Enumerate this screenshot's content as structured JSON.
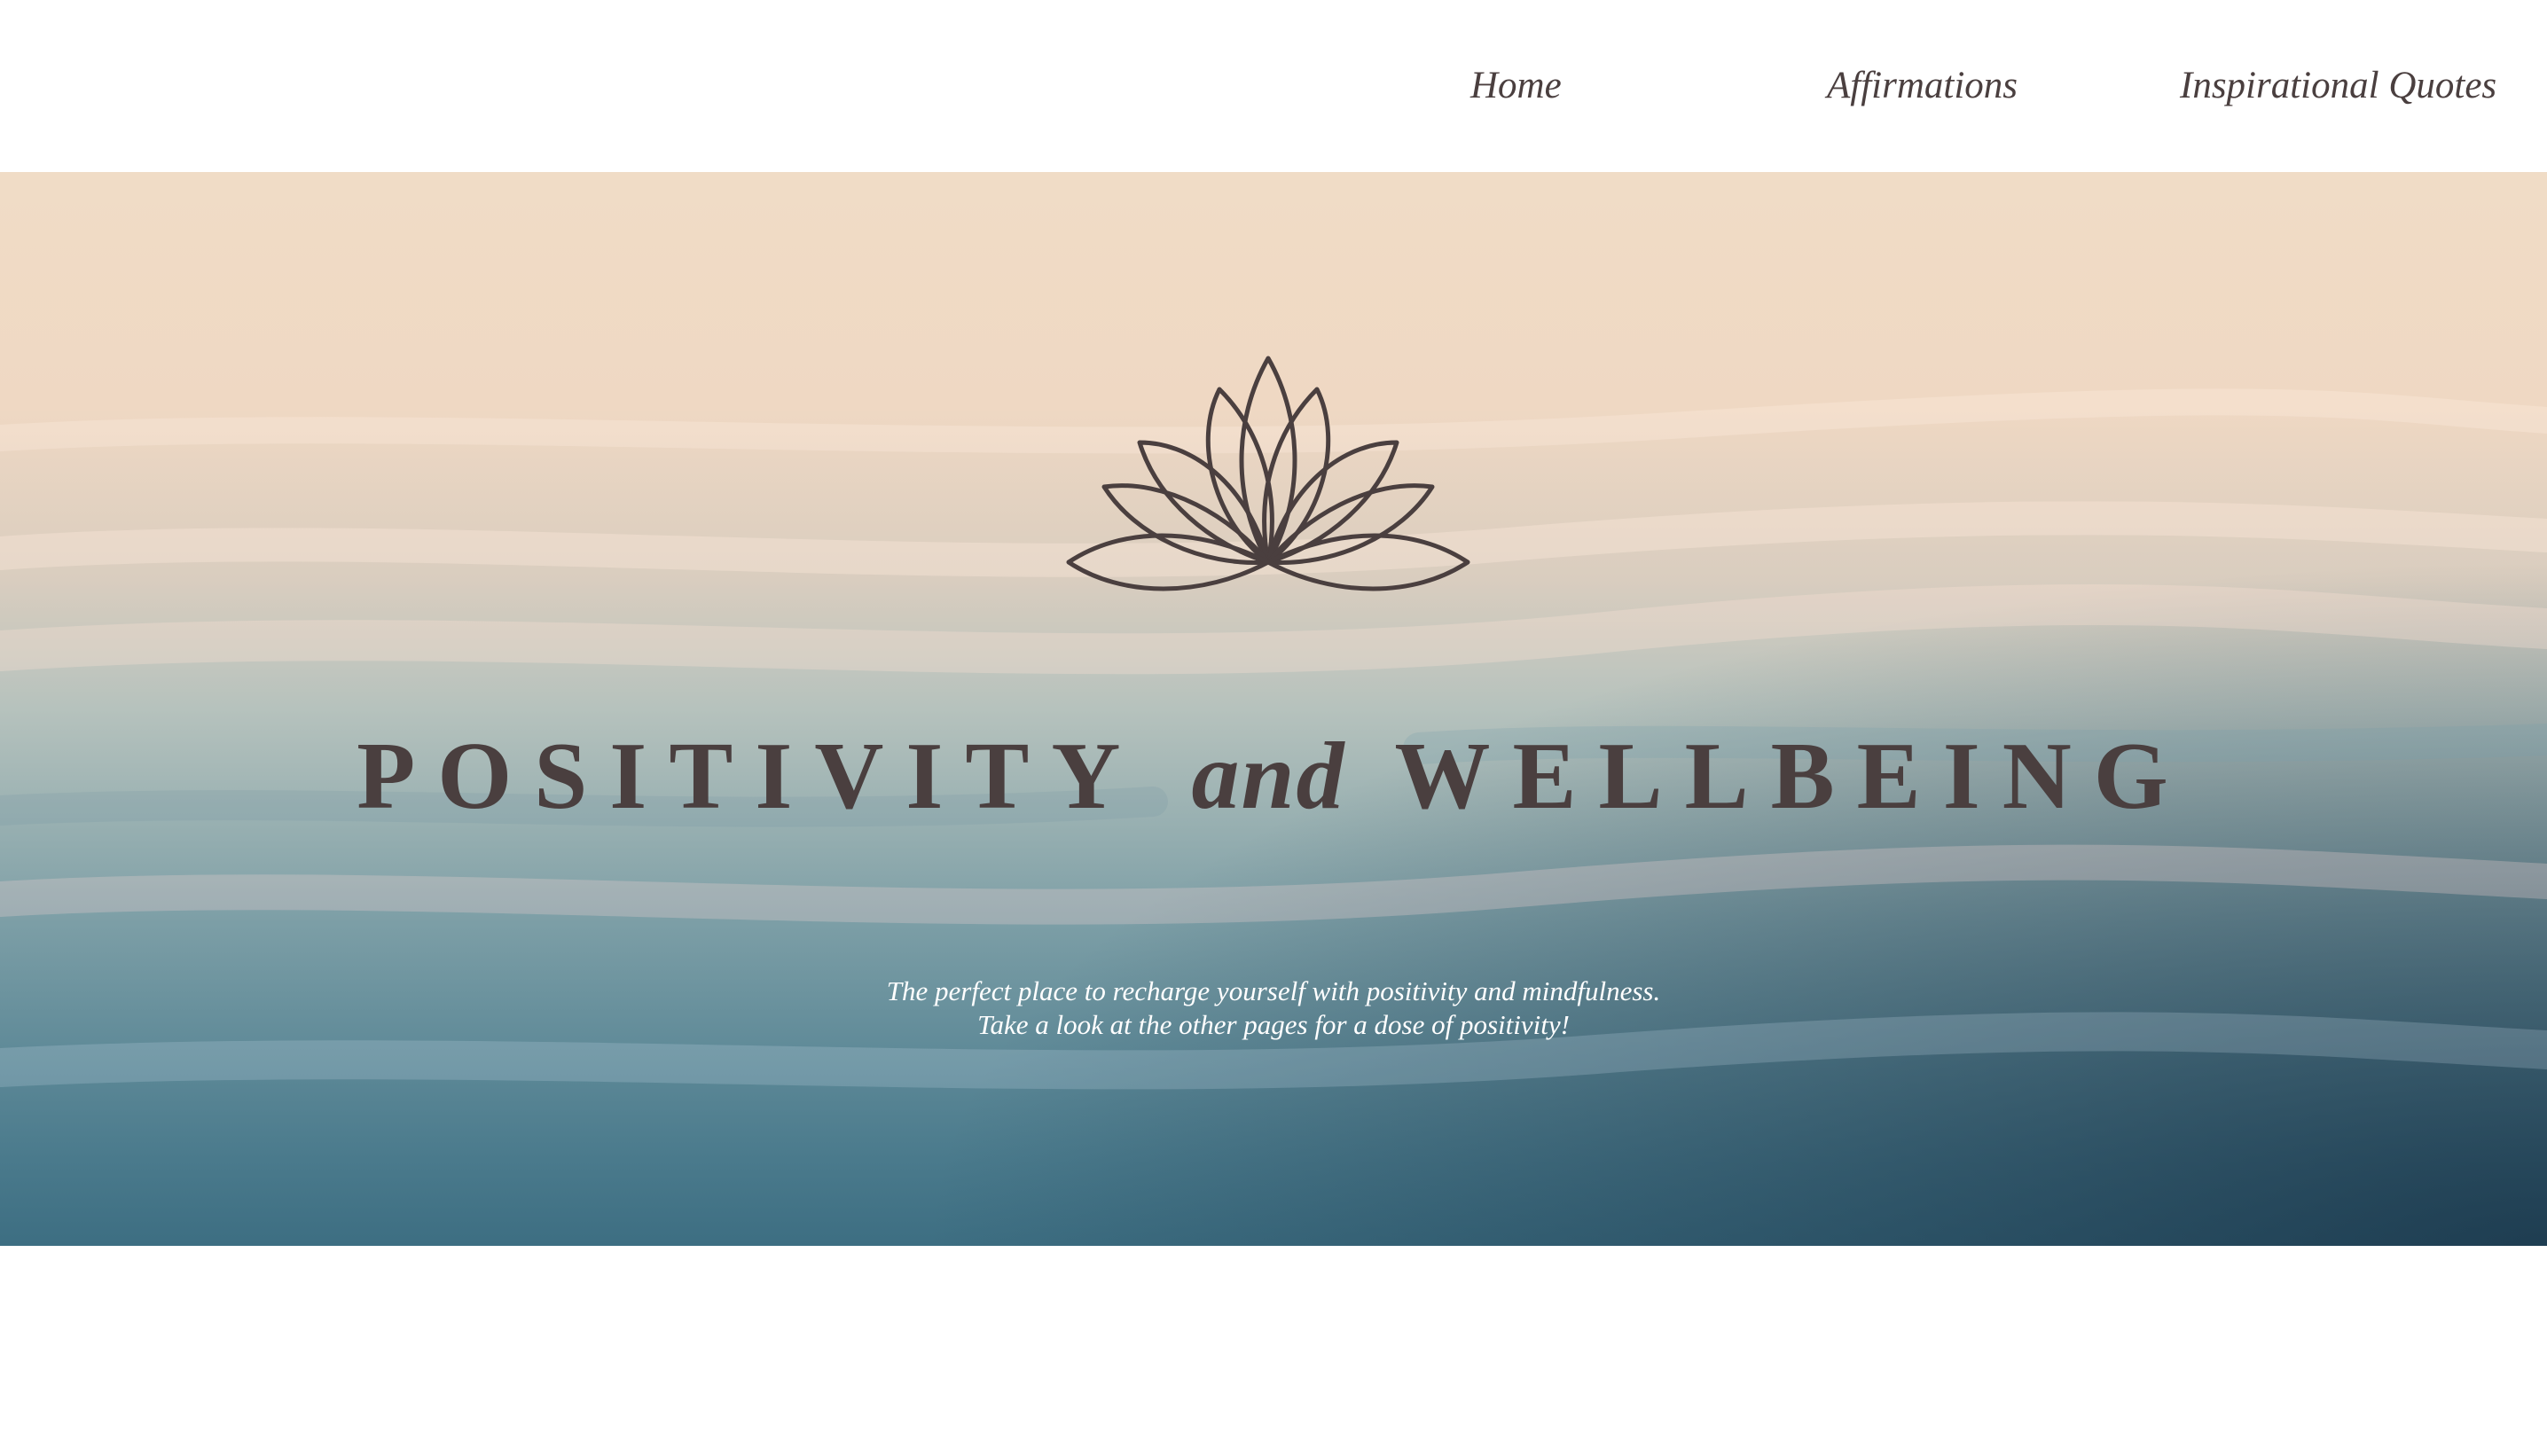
{
  "nav": {
    "items": [
      {
        "label": "Home"
      },
      {
        "label": "Affirmations"
      },
      {
        "label": "Inspirational Quotes"
      }
    ]
  },
  "hero": {
    "logo_icon": "lotus-icon",
    "title_left": "POSITIVITY",
    "title_middle": "and",
    "title_right": "WELLBEING",
    "tagline_line1": "The perfect place to recharge yourself with positivity and mindfulness.",
    "tagline_line2": "Take a look at the other pages for a dose of positivity!"
  },
  "colors": {
    "text_dark": "#4a3f3f",
    "tagline": "#ffffff",
    "hero_top": "#f0dcc6",
    "hero_bottom": "#3d6e82"
  }
}
